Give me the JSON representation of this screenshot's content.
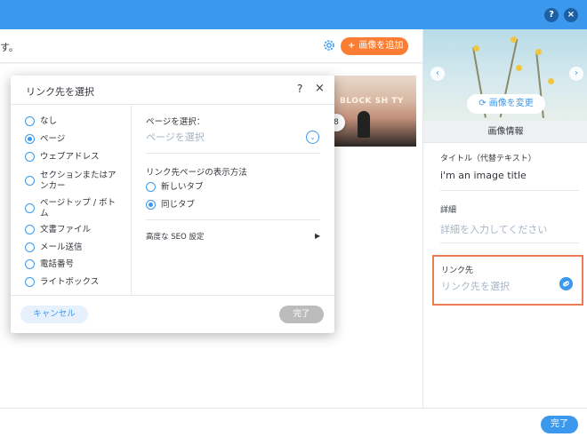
{
  "topbar": {
    "help": "?",
    "close": "×"
  },
  "main": {
    "header_text": "す。",
    "add_image_label": "画像を追加",
    "badge_count": "8",
    "photo_sign_text": "BLOCK SH TY"
  },
  "dialog": {
    "title": "リンク先を選択",
    "help": "?",
    "close": "×",
    "options": [
      {
        "label": "なし",
        "selected": false
      },
      {
        "label": "ページ",
        "selected": true
      },
      {
        "label": "ウェブアドレス",
        "selected": false
      },
      {
        "label": "セクションまたはアンカー",
        "label1": "セクションまたはア",
        "label2": "ンカー",
        "selected": false
      },
      {
        "label": "ページトップ / ボトム",
        "label1": "ページトップ / ボト",
        "label2": "ム",
        "selected": false
      },
      {
        "label": "文書ファイル",
        "selected": false
      },
      {
        "label": "メール送信",
        "selected": false
      },
      {
        "label": "電話番号",
        "selected": false
      },
      {
        "label": "ライトボックス",
        "selected": false
      }
    ],
    "page_select_label": "ページを選択：",
    "page_select_placeholder": "ページを選択",
    "display_method_label": "リンク先ページの表示方法",
    "new_tab_label": "新しいタブ",
    "same_tab_label": "同じタブ",
    "same_tab_selected": true,
    "seo_label": "高度な SEO 設定",
    "cancel_label": "キャンセル",
    "done_label": "完了"
  },
  "panel": {
    "change_image_label": "画像を変更",
    "title": "画像情報",
    "title_field_label": "タイトル（代替テキスト）",
    "title_field_value": "i'm an image title",
    "detail_label": "詳細",
    "detail_placeholder": "詳細を入力してください",
    "link_label": "リンク先",
    "link_placeholder": "リンク先を選択"
  },
  "footer": {
    "done_label": "完了"
  },
  "colors": {
    "accent": "#3b98ec",
    "add_button": "#fb7d33",
    "highlight_border": "#ec7b56"
  }
}
